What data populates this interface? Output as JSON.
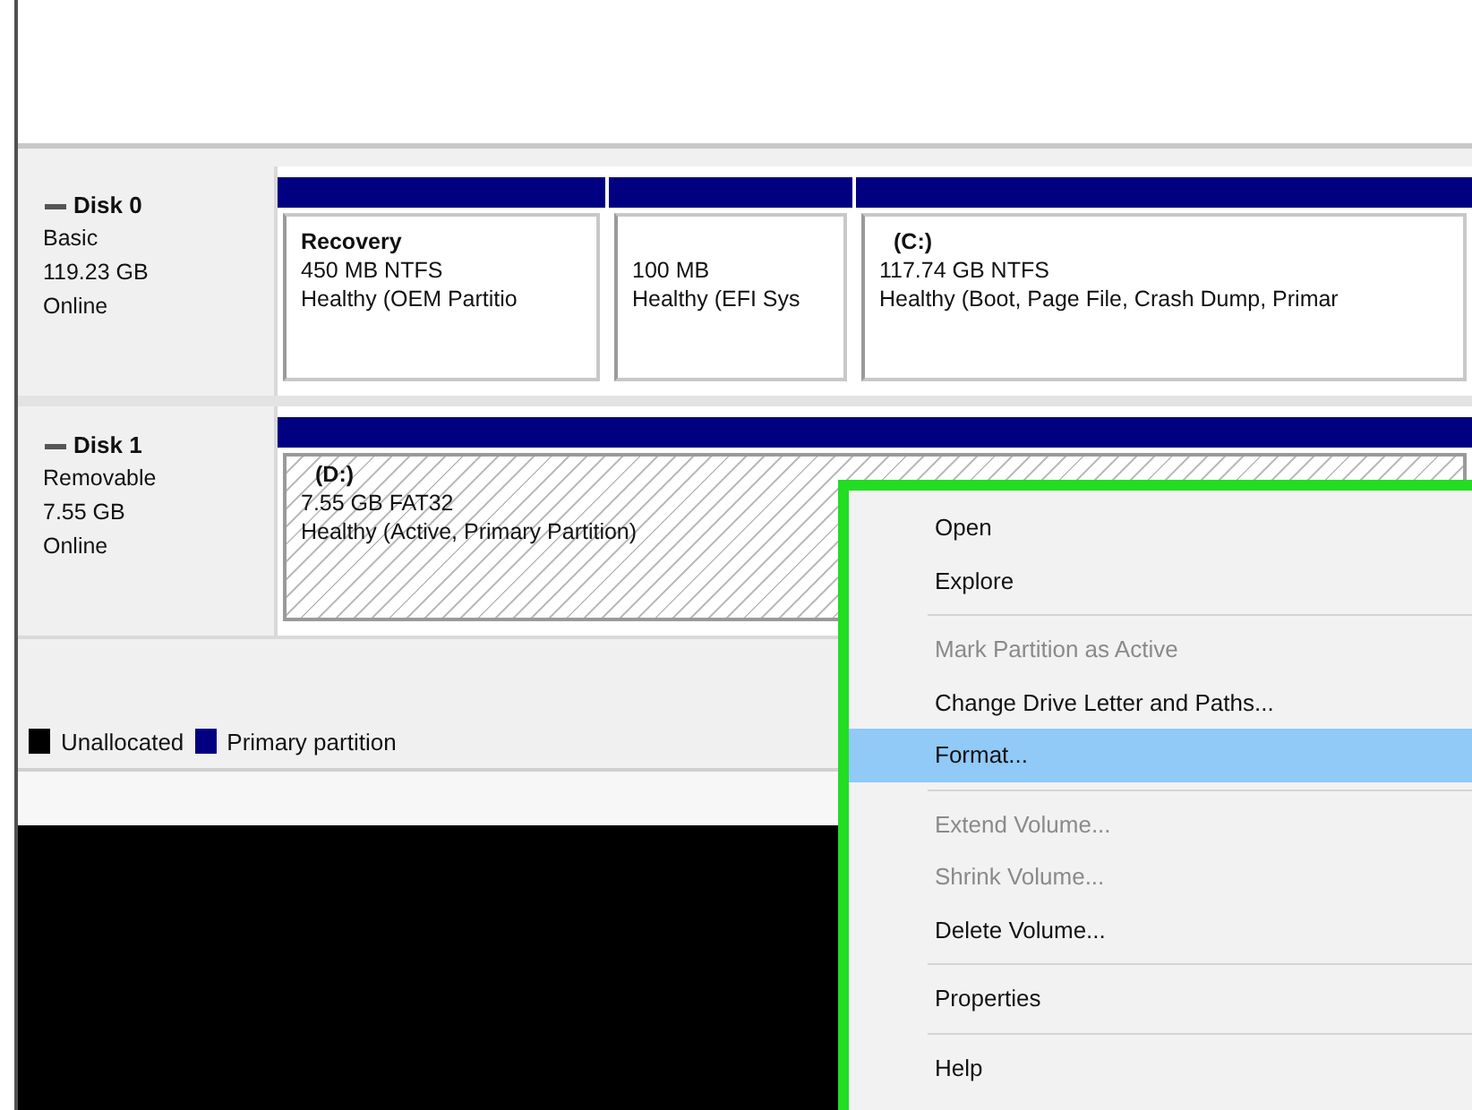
{
  "disks": [
    {
      "name": "Disk 0",
      "type": "Basic",
      "size": "119.23 GB",
      "status": "Online",
      "partitions": [
        {
          "label": "Recovery",
          "size": "450 MB NTFS",
          "status": "Healthy (OEM Partitio",
          "selected": false
        },
        {
          "size": "100 MB",
          "status": "Healthy (EFI Sys",
          "selected": false
        },
        {
          "label": "(C:)",
          "size": "117.74 GB NTFS",
          "status": "Healthy (Boot, Page File, Crash Dump, Primar",
          "selected": false
        }
      ]
    },
    {
      "name": "Disk 1",
      "type": "Removable",
      "size": "7.55 GB",
      "status": "Online",
      "partitions": [
        {
          "label": "(D:)",
          "size": "7.55 GB FAT32",
          "status": "Healthy (Active, Primary Partition)",
          "selected": true
        }
      ]
    }
  ],
  "legend": [
    {
      "label": "Unallocated",
      "color": "#000000"
    },
    {
      "label": "Primary partition",
      "color": "#000080"
    }
  ],
  "context_menu": [
    {
      "kind": "item",
      "label": "Open",
      "disabled": false,
      "selected": false
    },
    {
      "kind": "item",
      "label": "Explore",
      "disabled": false,
      "selected": false
    },
    {
      "kind": "separator"
    },
    {
      "kind": "item",
      "label": "Mark Partition as Active",
      "disabled": true,
      "selected": false
    },
    {
      "kind": "item",
      "label": "Change Drive Letter and Paths...",
      "disabled": false,
      "selected": false
    },
    {
      "kind": "item",
      "label": "Format...",
      "disabled": false,
      "selected": true
    },
    {
      "kind": "separator"
    },
    {
      "kind": "item",
      "label": "Extend Volume...",
      "disabled": true,
      "selected": false
    },
    {
      "kind": "item",
      "label": "Shrink Volume...",
      "disabled": true,
      "selected": false
    },
    {
      "kind": "item",
      "label": "Delete Volume...",
      "disabled": false,
      "selected": false
    },
    {
      "kind": "separator"
    },
    {
      "kind": "item",
      "label": "Properties",
      "disabled": false,
      "selected": false
    },
    {
      "kind": "separator"
    },
    {
      "kind": "item",
      "label": "Help",
      "disabled": false,
      "selected": false
    }
  ]
}
